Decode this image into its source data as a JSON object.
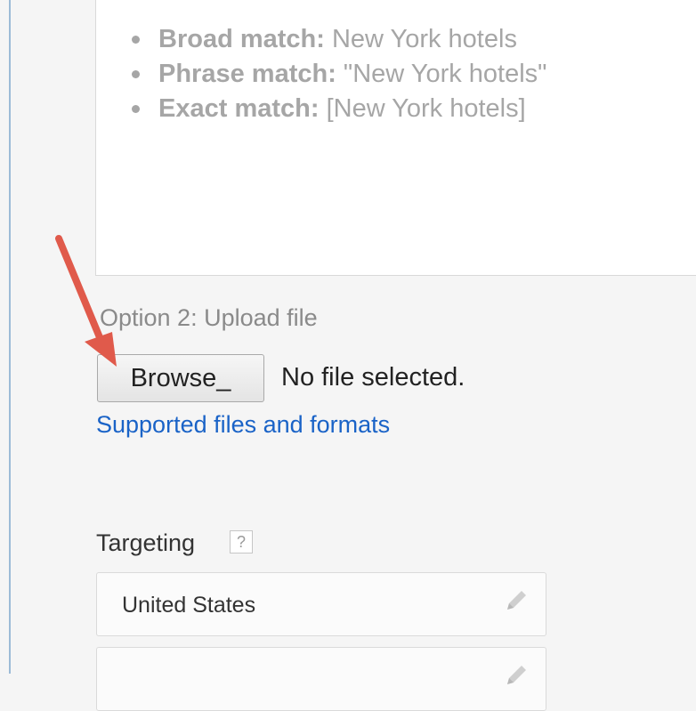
{
  "examples": [
    {
      "label": "Broad match:",
      "value": "New York hotels"
    },
    {
      "label": "Phrase match:",
      "value": "\"New York hotels\""
    },
    {
      "label": "Exact match:",
      "value": "[New York hotels]"
    }
  ],
  "upload": {
    "option_label": "Option 2: Upload file",
    "browse_label": "Browse_",
    "file_status": "No file selected.",
    "supported_link": "Supported files and formats"
  },
  "targeting": {
    "label": "Targeting",
    "help_icon": "?",
    "rows": [
      {
        "value": "United States",
        "icon": "pencil-icon"
      },
      {
        "value": "",
        "icon": "pencil-icon"
      }
    ]
  },
  "colors": {
    "link": "#1a63c7",
    "annotation_arrow": "#e05a4b",
    "window_border": "#9cbbd7"
  }
}
